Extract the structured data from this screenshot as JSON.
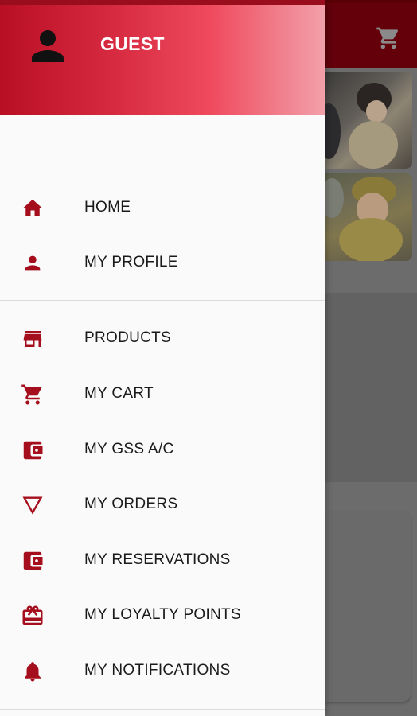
{
  "header": {
    "user_name": "GUEST",
    "avatar_icon": "person-icon"
  },
  "menu": {
    "section_one": [
      {
        "label": "HOME",
        "icon": "home-icon"
      },
      {
        "label": "MY PROFILE",
        "icon": "person-icon"
      }
    ],
    "section_two": [
      {
        "label": "PRODUCTS",
        "icon": "store-icon"
      },
      {
        "label": "MY CART",
        "icon": "cart-icon"
      },
      {
        "label": "MY GSS A/C",
        "icon": "wallet-icon"
      },
      {
        "label": "MY ORDERS",
        "icon": "triangle-down-icon"
      },
      {
        "label": "MY RESERVATIONS",
        "icon": "wallet-icon"
      },
      {
        "label": "MY LOYALTY POINTS",
        "icon": "gift-card-icon"
      },
      {
        "label": "MY NOTIFICATIONS",
        "icon": "bell-icon"
      }
    ]
  },
  "colors": {
    "accent": "#a50f1d",
    "header_start": "#b90f25",
    "header_end": "#f2a0aa",
    "drawer_bg": "#fafafa",
    "scrim": "#6c6c6c"
  },
  "background": {
    "toolbar_icon": "cart-icon"
  }
}
